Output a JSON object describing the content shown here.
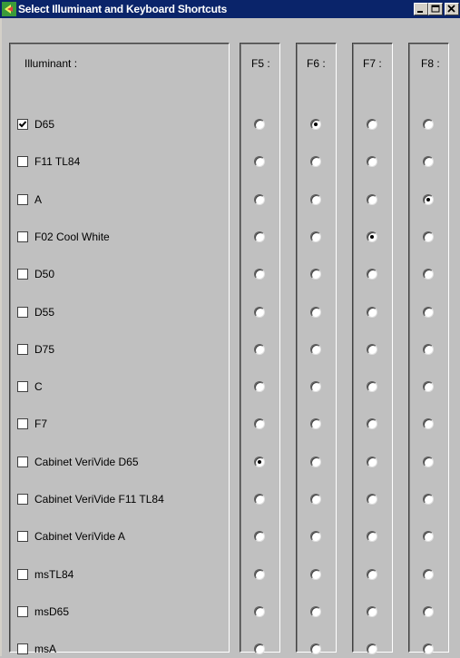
{
  "window": {
    "title": "Select Illuminant and Keyboard Shortcuts",
    "title_bar_color": "#0a246a",
    "icon": "palette-icon"
  },
  "illuminant_header": "Illuminant :",
  "shortcut_headers": [
    "F5 :",
    "F6 :",
    "F7 :",
    "F8 :"
  ],
  "rows": [
    {
      "label": "D65",
      "checked": true,
      "selected_key": "F6 :"
    },
    {
      "label": "F11 TL84",
      "checked": false,
      "selected_key": ""
    },
    {
      "label": "A",
      "checked": false,
      "selected_key": "F8 :"
    },
    {
      "label": "F02 Cool White",
      "checked": false,
      "selected_key": "F7 :"
    },
    {
      "label": "D50",
      "checked": false,
      "selected_key": ""
    },
    {
      "label": "D55",
      "checked": false,
      "selected_key": ""
    },
    {
      "label": "D75",
      "checked": false,
      "selected_key": ""
    },
    {
      "label": "C",
      "checked": false,
      "selected_key": ""
    },
    {
      "label": "F7",
      "checked": false,
      "selected_key": ""
    },
    {
      "label": "Cabinet VeriVide D65",
      "checked": false,
      "selected_key": "F5 :"
    },
    {
      "label": "Cabinet VeriVide F11 TL84",
      "checked": false,
      "selected_key": ""
    },
    {
      "label": "Cabinet VeriVide A",
      "checked": false,
      "selected_key": ""
    },
    {
      "label": "msTL84",
      "checked": false,
      "selected_key": ""
    },
    {
      "label": "msD65",
      "checked": false,
      "selected_key": ""
    },
    {
      "label": "msA",
      "checked": false,
      "selected_key": ""
    }
  ]
}
